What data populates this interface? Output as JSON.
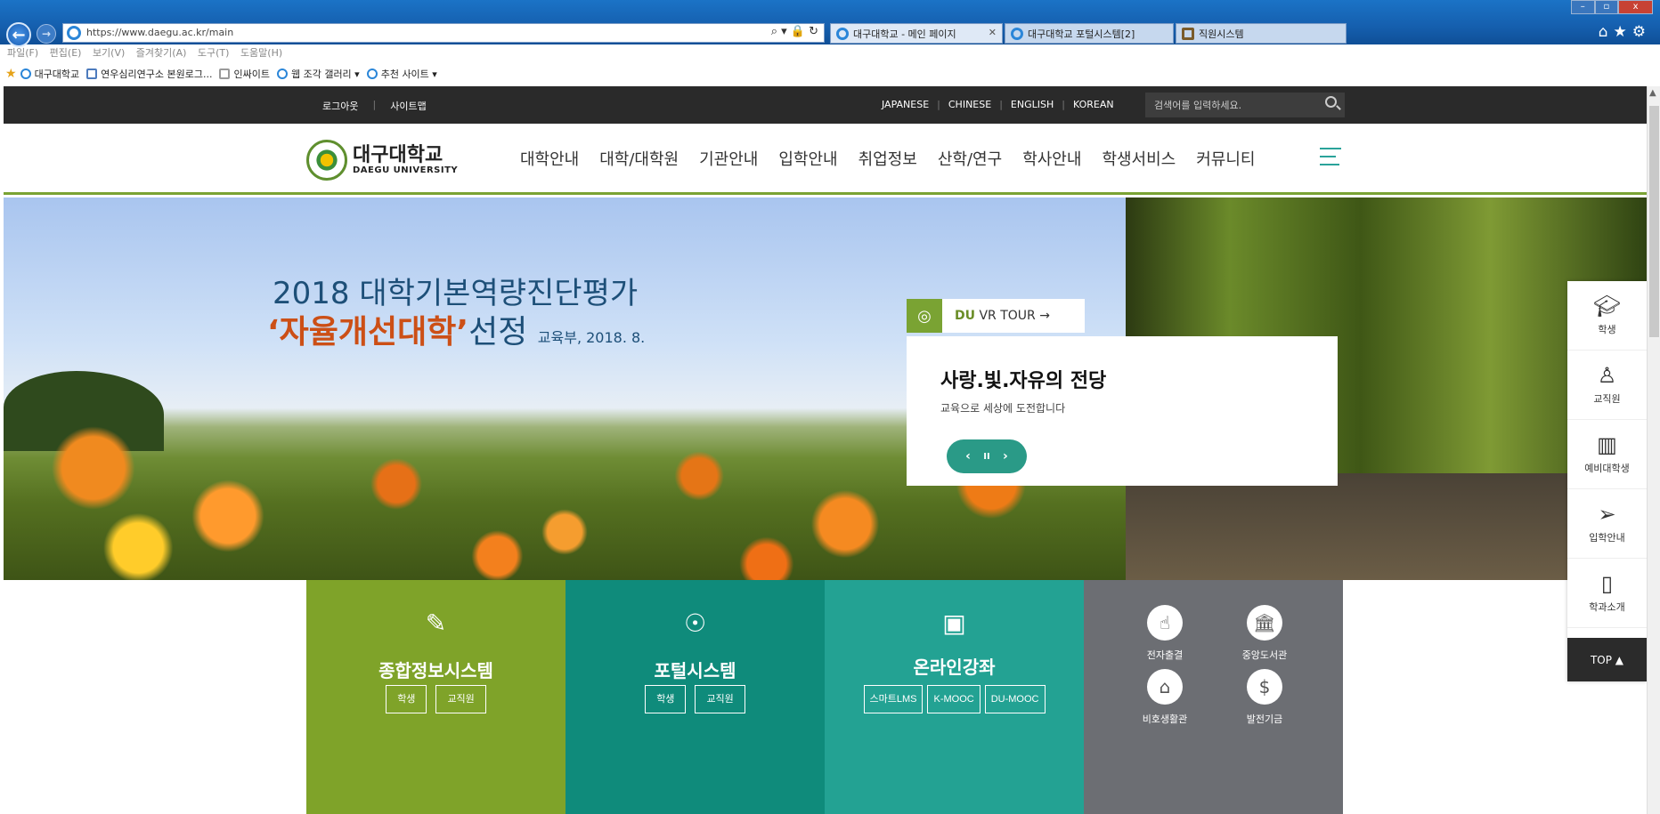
{
  "browser": {
    "url": "https://www.daegu.ac.kr/main",
    "tabs": [
      {
        "label": "대구대학교 - 메인 페이지",
        "active": true
      },
      {
        "label": "대구대학교 포털시스템[2]",
        "active": false
      },
      {
        "label": "직원시스템",
        "active": false
      }
    ],
    "menu": [
      "파일(F)",
      "편집(E)",
      "보기(V)",
      "즐겨찾기(A)",
      "도구(T)",
      "도움말(H)"
    ],
    "favorites": [
      "대구대학교",
      "연우심리연구소 본원로그...",
      "인싸이트",
      "웹 조각 갤러리 ▾",
      "추천 사이트 ▾"
    ],
    "window_controls": [
      "–",
      "▫",
      "x"
    ]
  },
  "util": {
    "logout": "로그아웃",
    "sitemap": "사이트맵",
    "languages": [
      "JAPANESE",
      "CHINESE",
      "ENGLISH",
      "KOREAN"
    ],
    "search_placeholder": "검색어를 입력하세요."
  },
  "logo": {
    "kor": "대구대학교",
    "eng": "DAEGU UNIVERSITY"
  },
  "nav": [
    "대학안내",
    "대학/대학원",
    "기관안내",
    "입학안내",
    "취업정보",
    "산학/연구",
    "학사안내",
    "학생서비스",
    "커뮤니티"
  ],
  "hero": {
    "title_line1": "2018 대학기본역량진단평가",
    "title_highlight": "‘자율개선대학’",
    "title_rest": "선정",
    "title_source": "교육부, 2018. 8.",
    "vr_brand": "DU",
    "vr_label": "VR TOUR →",
    "slogan": "사랑.빛.자유의 전당",
    "slogan_sub": "교육으로 세상에 도전합니다",
    "ctrl_prev": "‹",
    "ctrl_pause": "II",
    "ctrl_next": "›"
  },
  "quick_menu": [
    {
      "label": "학생",
      "icon": "graduation-cap-icon"
    },
    {
      "label": "교직원",
      "icon": "person-icon"
    },
    {
      "label": "예비대학생",
      "icon": "book-icon"
    },
    {
      "label": "입학안내",
      "icon": "paper-plane-icon"
    },
    {
      "label": "학과소개",
      "icon": "map-icon"
    }
  ],
  "top_label": "TOP ▲",
  "tiles": {
    "info": {
      "title": "종합정보시스템",
      "btns": [
        "학생",
        "교직원"
      ],
      "color": "#7fa329"
    },
    "portal": {
      "title": "포털시스템",
      "btns": [
        "학생",
        "교직원"
      ],
      "color": "#0f8b7b"
    },
    "online": {
      "title": "온라인강좌",
      "btns": [
        "스마트LMS",
        "K-MOOC",
        "DU-MOOC"
      ],
      "color": "#23a293"
    },
    "etc": {
      "items": [
        "전자출결",
        "중앙도서관",
        "비호생활관",
        "발전기금"
      ],
      "color": "#6c6e73"
    }
  }
}
